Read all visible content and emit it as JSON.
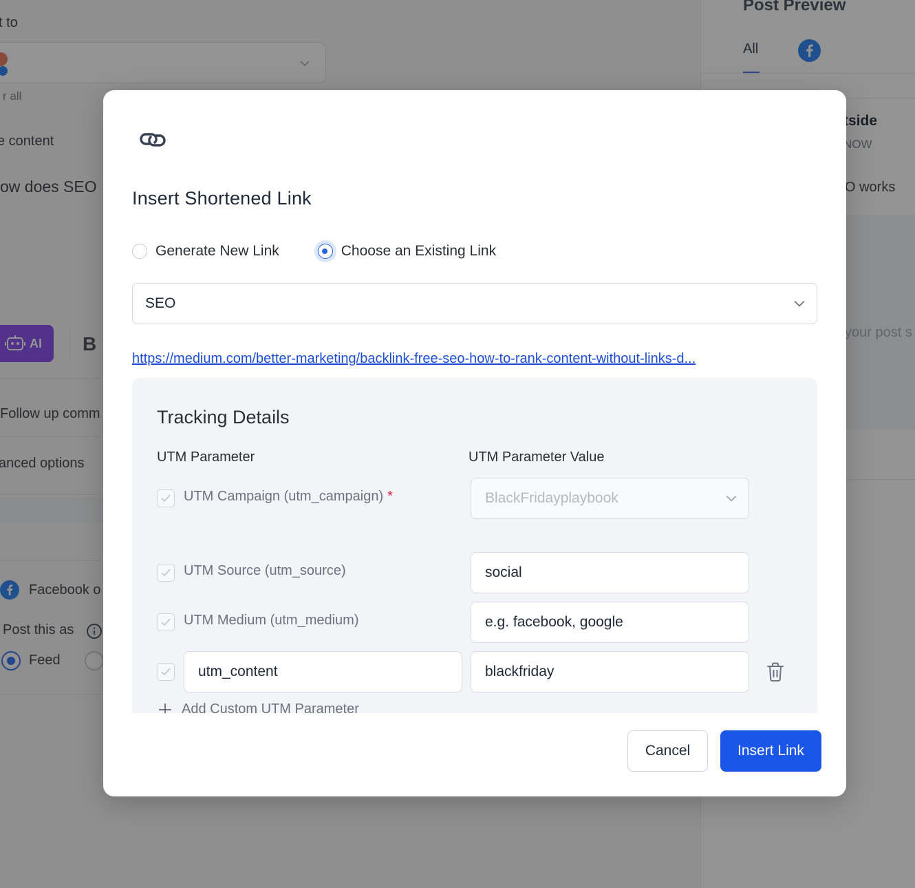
{
  "background": {
    "post_to_label": "t to",
    "select_all_text": "r all",
    "content_label": "e content",
    "post_text_fragment": "ow does SEO",
    "ai_button_label": "AI",
    "bold_label": "B",
    "follow_up_text": "Follow up comm",
    "advanced_options_text": "anced options",
    "facebook_text": "Facebook o",
    "post_this_as_label": "Post this as",
    "feed_label": "Feed",
    "preview": {
      "title": "Post Preview",
      "tab_all": "All",
      "page_name_fragment": "tside",
      "time_fragment": "NOW",
      "text_fragment": "O works",
      "hint_fragment": "your post s"
    }
  },
  "modal": {
    "title": "Insert Shortened Link",
    "radio_options": [
      {
        "label": "Generate New Link",
        "checked": false
      },
      {
        "label": "Choose an Existing Link",
        "checked": true
      }
    ],
    "link_select_value": "SEO",
    "link_url": "https://medium.com/better-marketing/backlink-free-seo-how-to-rank-content-without-links-d...",
    "tracking": {
      "title": "Tracking Details",
      "col_parameter": "UTM Parameter",
      "col_value": "UTM Parameter Value",
      "rows": [
        {
          "label": "UTM Campaign (utm_campaign)",
          "required_mark": "*",
          "value": "BlackFridayplaybook"
        },
        {
          "label": "UTM Source (utm_source)",
          "value": "social"
        },
        {
          "label": "UTM Medium (utm_medium)",
          "value": "e.g. facebook, google"
        },
        {
          "key": "utm_content",
          "value": "blackfriday"
        }
      ],
      "add_custom_label": "Add Custom UTM Parameter"
    },
    "cancel_label": "Cancel",
    "insert_label": "Insert Link"
  },
  "colors": {
    "primary": "#1a56e8",
    "link": "#1d4ed8",
    "required": "#e11d48",
    "ai_purple": "#7c3aed"
  }
}
